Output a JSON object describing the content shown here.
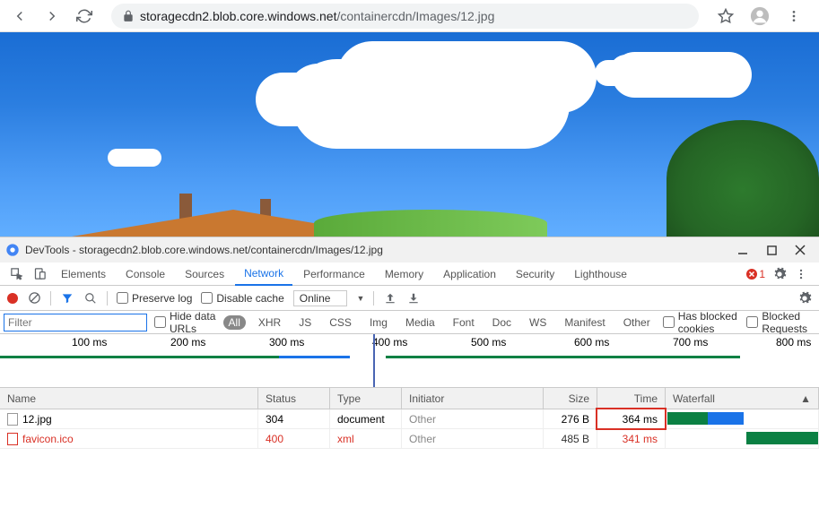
{
  "browser": {
    "url_host": "storagecdn2.blob.core.windows.net",
    "url_path": "/containercdn/Images/12.jpg"
  },
  "devtools": {
    "title": "DevTools - storagecdn2.blob.core.windows.net/containercdn/Images/12.jpg",
    "tabs": [
      "Elements",
      "Console",
      "Sources",
      "Network",
      "Performance",
      "Memory",
      "Application",
      "Security",
      "Lighthouse"
    ],
    "active_tab": "Network",
    "error_count": "1",
    "toolbar": {
      "preserve_log": "Preserve log",
      "disable_cache": "Disable cache",
      "throttle": "Online"
    },
    "filter": {
      "placeholder": "Filter",
      "hide_data_urls": "Hide data URLs",
      "types": [
        "All",
        "XHR",
        "JS",
        "CSS",
        "Img",
        "Media",
        "Font",
        "Doc",
        "WS",
        "Manifest",
        "Other"
      ],
      "active_type": "All",
      "has_blocked_cookies": "Has blocked cookies",
      "blocked_requests": "Blocked Requests"
    },
    "timeline": {
      "ticks": [
        "100 ms",
        "200 ms",
        "300 ms",
        "400 ms",
        "500 ms",
        "600 ms",
        "700 ms",
        "800 ms"
      ]
    },
    "columns": {
      "name": "Name",
      "status": "Status",
      "type": "Type",
      "initiator": "Initiator",
      "size": "Size",
      "time": "Time",
      "waterfall": "Waterfall"
    },
    "rows": [
      {
        "name": "12.jpg",
        "status": "304",
        "type": "document",
        "initiator": "Other",
        "size": "276 B",
        "time": "364 ms",
        "error": false
      },
      {
        "name": "favicon.ico",
        "status": "400",
        "type": "xml",
        "initiator": "Other",
        "size": "485 B",
        "time": "341 ms",
        "error": true
      }
    ]
  }
}
